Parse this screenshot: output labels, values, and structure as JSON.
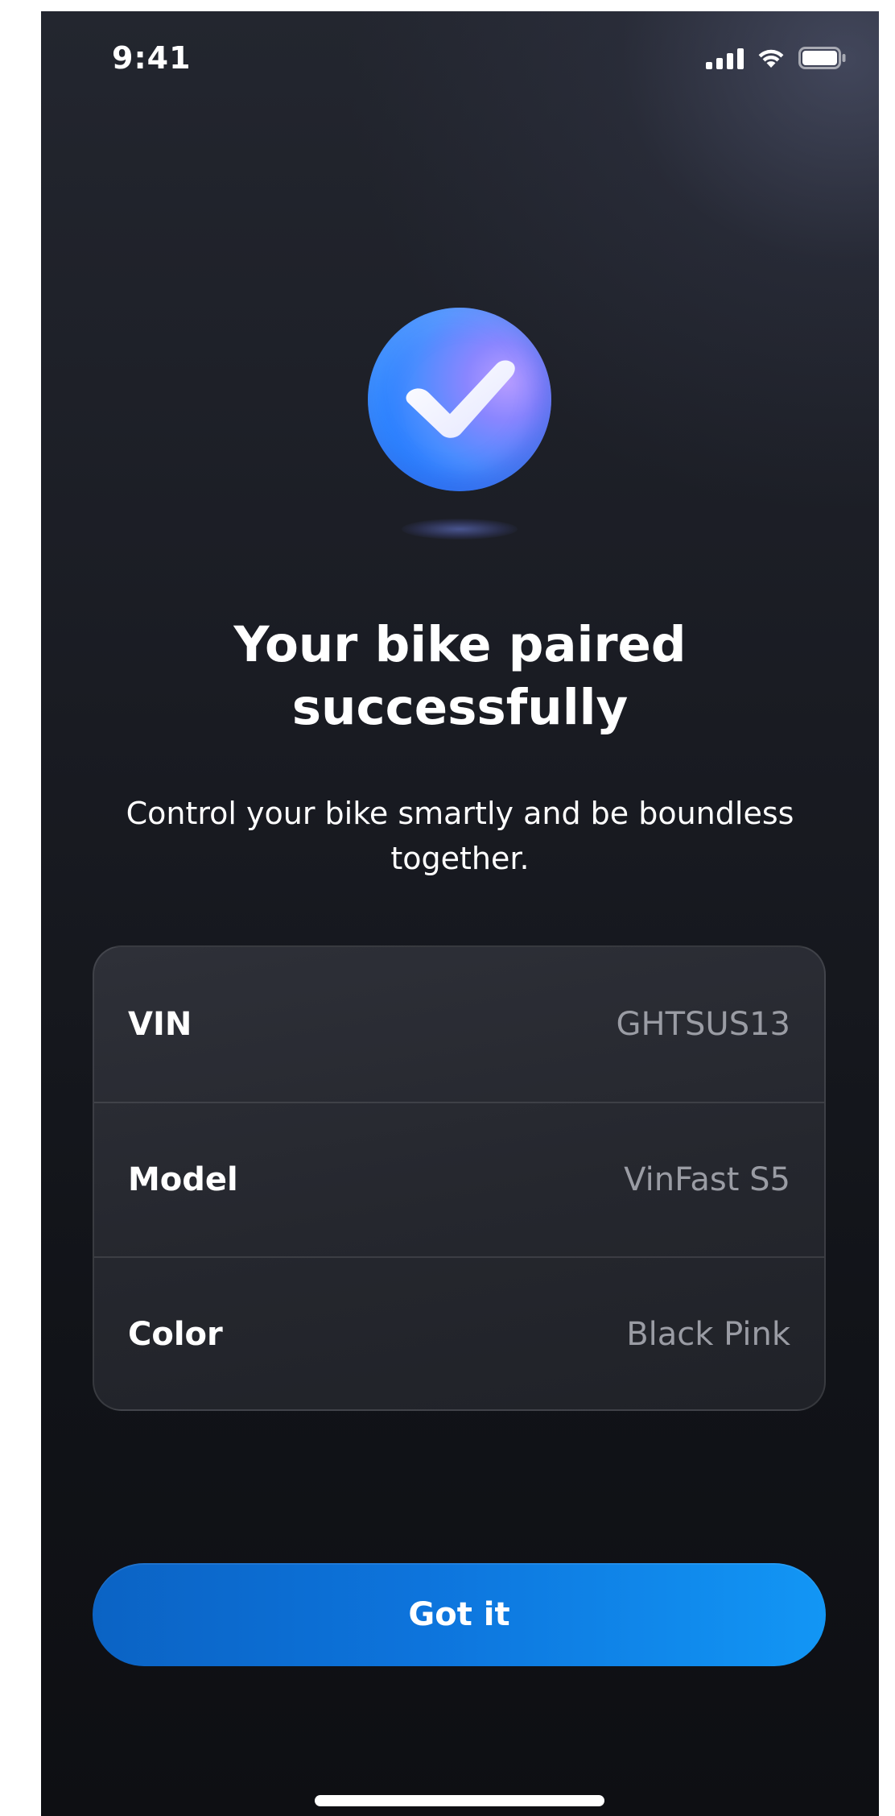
{
  "status_bar": {
    "time": "9:41",
    "icons": [
      "signal-icon",
      "wifi-icon",
      "battery-icon"
    ]
  },
  "success_icon": "checkmark-icon",
  "title_lines": [
    "Your bike paired",
    "successfully"
  ],
  "subtitle": "Control your bike smartly and be boundless together.",
  "info_rows": [
    {
      "label": "VIN",
      "value": "GHTSUS13"
    },
    {
      "label": "Model",
      "value": "VinFast S5"
    },
    {
      "label": "Color",
      "value": "Black Pink"
    }
  ],
  "primary_button": {
    "label": "Got it"
  },
  "colors": {
    "background": "#15171d",
    "card": "#2a2c33",
    "accent": "#0d7ae0",
    "muted_text": "#9a9ca4"
  }
}
